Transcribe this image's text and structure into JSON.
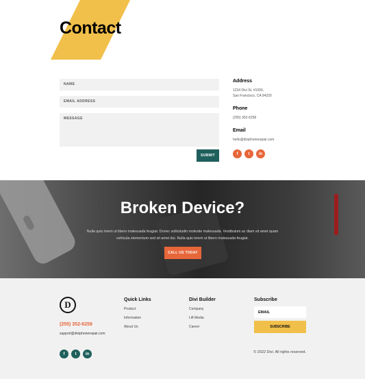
{
  "hero": {
    "title": "Contact"
  },
  "form": {
    "name_placeholder": "NAME",
    "email_placeholder": "EMAIL ADDRESS",
    "message_placeholder": "MESSAGE",
    "submit_label": "SUBMIT"
  },
  "info": {
    "address_heading": "Address",
    "address_line1": "1234 Divi St. #1000,",
    "address_line2": "San Francisco, CA 94220",
    "phone_heading": "Phone",
    "phone_value": "(255) 352-6258",
    "email_heading": "Email",
    "email_value": "hello@diviphonerepair.com",
    "social": [
      "f",
      "t",
      "in"
    ]
  },
  "banner": {
    "title": "Broken Device?",
    "text_line1": "Nulla quis lorem ut libero malesuada feugiat. Donec sollicitudin molestie malesuada. Vestibulum ac diam sit amet quam",
    "text_line2": "vehicula elementum sed sit amet dui. Nulla quis lorem ut libero malesuada feugiat.",
    "cta_label": "CALL US TODAY"
  },
  "footer": {
    "logo_letter": "D",
    "phone": "(255) 352-6258",
    "email": "support@diviphonerepair.com",
    "quick_links_heading": "Quick Links",
    "quick_links": [
      "Product",
      "Information",
      "About Us"
    ],
    "divi_heading": "Divi Builder",
    "divi_links": [
      "Company",
      "Lift Media",
      "Career"
    ],
    "subscribe_heading": "Subscribe",
    "subscribe_placeholder": "EMAIL",
    "subscribe_button": "SUBSCRIBE",
    "copyright": "© 2022 Divi. All rights reserved.",
    "social": [
      "f",
      "t",
      "in"
    ]
  },
  "colors": {
    "accent_yellow": "#f1c04a",
    "accent_orange": "#e7663a",
    "accent_teal": "#1f5f5c"
  }
}
